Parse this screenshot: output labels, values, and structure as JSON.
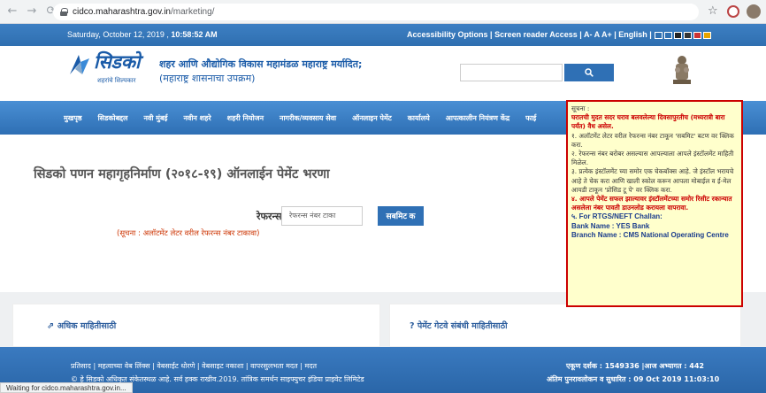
{
  "browser": {
    "url_host": "cidco.maharashtra.gov.in",
    "url_path": "/marketing/",
    "status_text": "Waiting for cidco.maharashtra.gov.in..."
  },
  "topbar": {
    "date": "Saturday, October 12, 2019 ,",
    "time": "10:58:52 AM",
    "accessibility": "Accessibility Options",
    "screen_reader": "Screen reader Access",
    "font_sizes": "A-  A  A+",
    "language": "English",
    "swatch_colors": [
      "#2f6fb0",
      "#2f6fb0",
      "#222222",
      "#333333",
      "#cc3333",
      "#e8a400"
    ]
  },
  "header": {
    "logo_text": "सिडको",
    "logo_tagline": "शहरांचे शिल्पकार",
    "org_line1": "शहर आणि औद्योगिक विकास महामंडळ महाराष्ट्र मर्यादित;",
    "org_line2": "(महाराष्ट्र शासनाचा उपक्रम)",
    "search_placeholder": "",
    "emblem_caption": "सत्यमेव जयते"
  },
  "nav": {
    "items": [
      "मुखपृष्ठ",
      "सिडकोबद्दल",
      "नवी मुंबई",
      "नवीन शहरे",
      "शहरी नियोजन",
      "नागरीक/व्यवसाय सेवा",
      "ऑनलाइन पेमेंट",
      "कार्यालये",
      "आपत्कालीन नियंत्रण केंद्र",
      "फाई"
    ]
  },
  "notice": {
    "title": "सूचना :",
    "line1": "घरातची मुदत सदर घराव बलवलेल्या दिवसापुरतीच (मध्यरात्री बारा पर्यंत) वैध असेल.",
    "line2": "१. अलॉटमेंट लेटर वरील रेफरन्स नंबर टाकून 'सबमिट' बटण वर क्लिक करा.",
    "line3": "२. रेफरन्स नंबर बरोबर असल्यास आपल्याला आपले इंस्टॉलमेंट माहिती मिळेल.",
    "line4": "३. प्रत्येक इंस्टॉलमेंट च्या समोर एक चेकबॉक्स आहे. जे इंस्टॉल भरायचे आहे ते चेक करा आणि खाली स्कोल करून आपला मोबाईल व ई-मेल आयडी टाकून 'प्रोसिड टू पे' वर क्लिक करा.",
    "line5": "४. आपले पेमेंट सफल झाल्यावर इंस्टॉलमेंटच्या समोर रिसीट रकान्यात असलेला नंबर पावती डाउनलोड करायला वापरावा.",
    "line6": "५. For RTGS/NEFT Challan:",
    "bank": "Bank Name : YES Bank",
    "branch": "Branch Name : CMS National Operating Centre"
  },
  "main": {
    "title": "सिडको पणन महागृहनिर्माण (२०१८-१९) ऑनलाईन पेमेंट भरणा",
    "ref_label": "रेफरन्स नंबर :",
    "ref_placeholder": "रेफरन्स नंबर टाका",
    "ref_note": "(सूचना : अलॉटमेंट लेटर वरील रेफरन्स नंबर टाकावा)",
    "submit_label": "सबमिट क"
  },
  "boxes": {
    "left_label": "अधिक माहितीसाठी",
    "right_label": "? पेमेंट गेटवे संबंधी माहितीसाठी"
  },
  "footer": {
    "links": "प्रतिसाद | महत्वाच्या वेब लिंक्स | वेबसाईट धोरणे | वेबसाइट नकाशा | वापरसुलभता मदत | मदत",
    "copyright": "© हे सिडको अधिकृत संकेतस्थळ आहे. सर्व हक्क राखीव.2019. तांत्रिक समर्थन साइफ्युचर इंडिया प्राइवेट लिमिटेड",
    "visitors": "एकूण दर्शक : 1549336 |आज अभ्यागत : 442",
    "updated": "अंतिम पुनरावलोकन व सुधारित : 09 Oct 2019 11:03:10"
  }
}
